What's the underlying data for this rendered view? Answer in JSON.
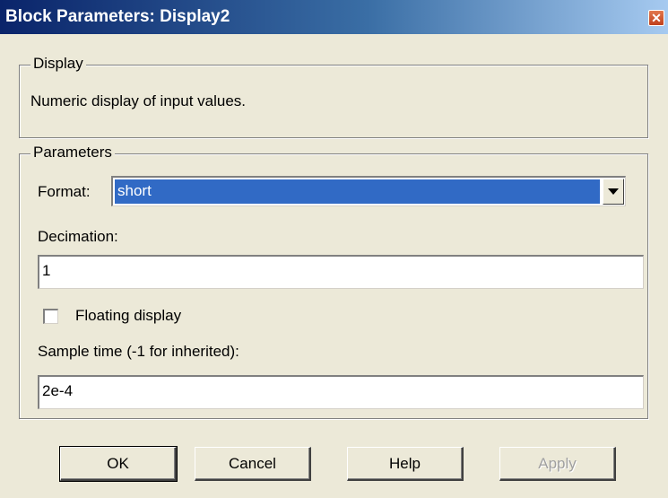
{
  "window": {
    "title": "Block Parameters: Display2"
  },
  "display_group": {
    "legend": "Display",
    "description": "Numeric display of input values."
  },
  "parameters_group": {
    "legend": "Parameters",
    "format": {
      "label": "Format:",
      "value": "short"
    },
    "decimation": {
      "label": "Decimation:",
      "value": "1"
    },
    "floating": {
      "label": "Floating display",
      "checked": false
    },
    "sample_time": {
      "label": "Sample time (-1 for inherited):",
      "value": "2e-4"
    }
  },
  "buttons": {
    "ok": "OK",
    "cancel": "Cancel",
    "help": "Help",
    "apply": "Apply"
  },
  "colors": {
    "accent": "#316ac5",
    "titlebar": "#0a246a",
    "face": "#ece9d8"
  }
}
